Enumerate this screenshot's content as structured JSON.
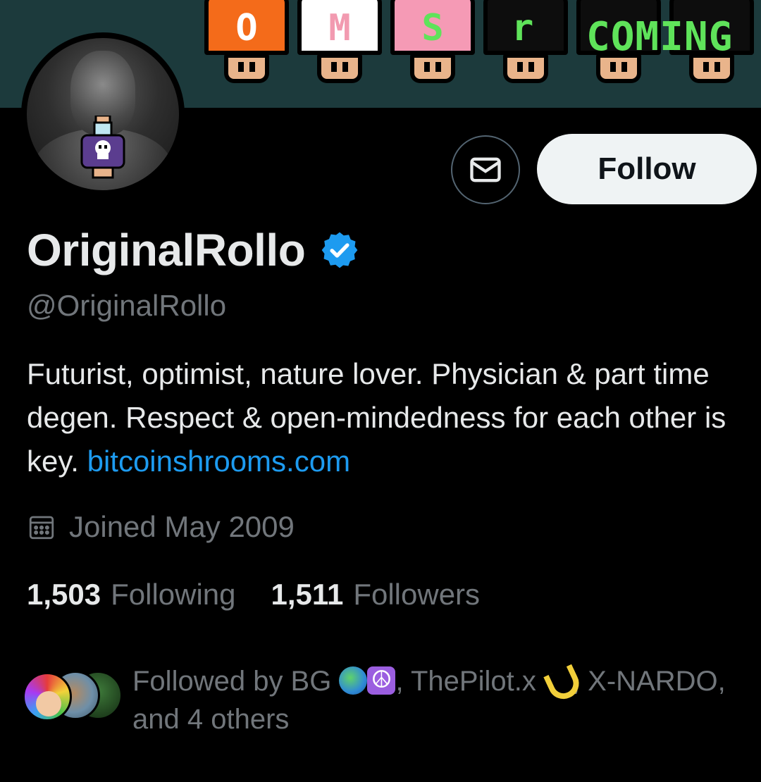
{
  "banner": {
    "shrooms": [
      {
        "letter": "O",
        "cap_color": "#f46b1a",
        "letter_color": "#ffffff"
      },
      {
        "letter": "M",
        "cap_color": "#ffffff",
        "letter_color": "#f29ab0"
      },
      {
        "letter": "S",
        "cap_color": "#f59ab5",
        "letter_color": "#5fe35a"
      },
      {
        "letter": "r",
        "cap_color": "#0d0d0d",
        "letter_color": "#5fe35a"
      },
      {
        "letter": "",
        "cap_color": "#0d0d0d",
        "letter_color": "#5fe35a"
      },
      {
        "letter": "",
        "cap_color": "#0d0d0d",
        "letter_color": "#5fe35a"
      }
    ],
    "word": "COMING"
  },
  "profile": {
    "display_name": "OriginalRollo",
    "handle": "@OriginalRollo",
    "verified": true,
    "bio_text": "Futurist, optimist, nature lover. Physician & part time degen. Respect & open-mindedness for each other is key. ",
    "bio_link": "bitcoinshrooms.com",
    "joined": "Joined May 2009"
  },
  "actions": {
    "follow_label": "Follow",
    "message_icon": "envelope-icon"
  },
  "stats": {
    "following_count": "1,503",
    "following_label": "Following",
    "followers_count": "1,511",
    "followers_label": "Followers"
  },
  "followed_by": {
    "prefix": "Followed by BG ",
    "name2": ", ThePilot.x ",
    "name3": ", X-NARDO,",
    "suffix": "and 4 others"
  },
  "colors": {
    "accent": "#1d9bf0",
    "muted": "#71767b",
    "banner_bg": "#1c3a3c"
  }
}
